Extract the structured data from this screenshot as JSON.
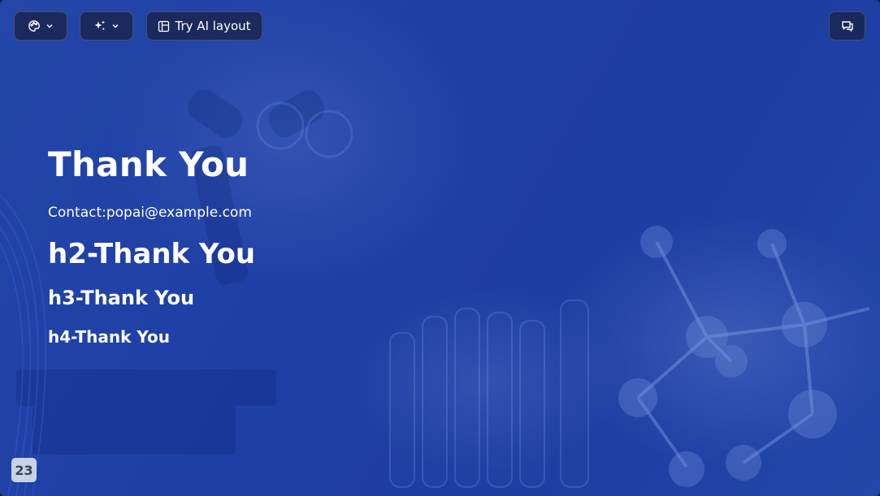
{
  "toolbar": {
    "theme_icon": "palette-icon",
    "ai_icon": "sparkle-icon",
    "layout_icon": "layout-icon",
    "layout_label": "Try AI layout",
    "comment_icon": "comment-icon",
    "chevron_icon": "chevron-down-icon"
  },
  "slide": {
    "title": "Thank You",
    "contact": "Contact:popai@example.com",
    "h2": "h2-Thank You",
    "h3": "h3-Thank You",
    "h4": "h4-Thank You",
    "page_number": "23",
    "background_color": "#1e3fa6"
  }
}
